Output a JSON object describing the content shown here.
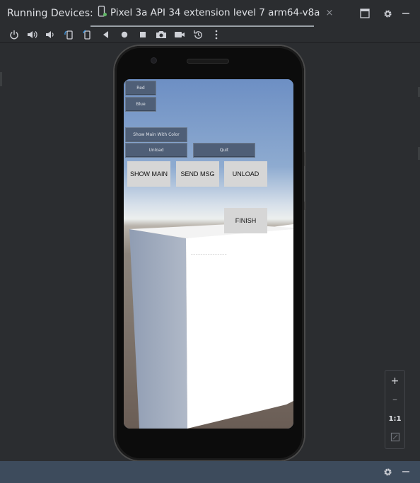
{
  "header": {
    "tool_window_title": "Running Devices:",
    "device_tab_label": "Pixel 3a API 34 extension level 7 arm64-v8a",
    "device_tab_icon": "phone-icon",
    "close_tab_icon": "close-icon",
    "close_glyph": "×",
    "actions": [
      "window-layout-icon",
      "gear-icon",
      "minimize-icon"
    ]
  },
  "toolbar": {
    "buttons": [
      "power-icon",
      "volume-up-icon",
      "volume-down-icon",
      "rotate-left-icon",
      "rotate-right-icon",
      "back-icon",
      "home-icon",
      "overview-icon",
      "camera-icon",
      "screen-record-icon",
      "reset-icon",
      "more-icon"
    ]
  },
  "app": {
    "small_buttons": {
      "red": "Red",
      "blue": "Blue",
      "show_main_with_color": "Show Main With Color",
      "unload": "Unload",
      "quit": "Quit"
    },
    "action_buttons": {
      "show_main": "SHOW MAIN",
      "send_msg": "SEND MSG",
      "unload": "UNLOAD",
      "finish": "FINISH"
    },
    "tiny_text": "— — — — — — — — — — — — — — —"
  },
  "zoom": {
    "plus": "+",
    "minus": "–",
    "actual_size": "1:1",
    "fit_icon": "fit-screen-icon"
  },
  "bottombar": {
    "actions": [
      "gear-icon",
      "minimize-icon"
    ]
  },
  "colors": {
    "ide_bg": "#2b2d30",
    "bottom_bar": "#3d4b5c",
    "sky_top": "#6d8fc4",
    "unity_button": "#4f5f77",
    "android_button": "#d6d6d6"
  }
}
